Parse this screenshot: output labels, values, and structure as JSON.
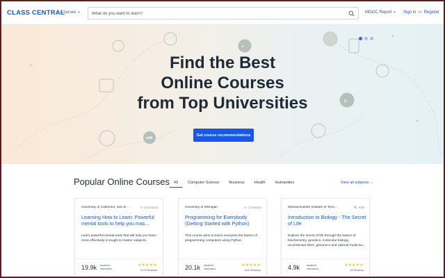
{
  "header": {
    "logo": "CLASS CENTRAL",
    "courses_label": "Courses",
    "search_placeholder": "What do you want to learn?",
    "mooc_report_label": "MOOC Report",
    "signin_label": "Sign in",
    "or_label": "or",
    "register_label": "Register"
  },
  "hero": {
    "title_line1": "Find the Best",
    "title_line2": "Online Courses",
    "title_line3": "from Top Universities",
    "cta_label": "Get course recommendations",
    "carousel_active_index": 0,
    "carousel_count": 3
  },
  "popular": {
    "title": "Popular Online Courses",
    "tabs": [
      "All",
      "Computer Science",
      "Business",
      "Health",
      "Humanities"
    ],
    "active_tab": "All",
    "view_all_label": "View all subjects →"
  },
  "cards": [
    {
      "university": "University of California, San D...",
      "provider": "Coursera",
      "title": "Learning How to Learn: Powerful mental tools to help you mas...",
      "description": "Learn powerful mental tools that will help you learn more effectively in tough-to-master subjects.",
      "count": "19.9k",
      "count_label1": "students",
      "count_label2": "interested",
      "stars": "★★★★★",
      "reviews": "2173 Reviews"
    },
    {
      "university": "University of Michigan",
      "provider": "Coursera",
      "title": "Programming for Everybody (Getting Started with Python)",
      "description": "This course aims to teach everyone the basics of programming computers using Python.",
      "count": "20.1k",
      "count_label1": "students",
      "count_label2": "interested",
      "stars": "★★★★★",
      "reviews": "1410 Reviews"
    },
    {
      "university": "Massachusetts Institute of Tech...",
      "provider": "edX",
      "title": "Introduction to Biology - The Secret of Life",
      "description": "Explore the secret of life through the basics of biochemistry, genetics, molecular biology, recombinant DNA, genomics and rational medicine.",
      "count": "4.9k",
      "count_label1": "students",
      "count_label2": "interested",
      "stars": "★★★★★",
      "reviews": "25 Reviews"
    }
  ],
  "colors": {
    "brand_blue": "#1a56c9",
    "cta_blue": "#1a56e8",
    "star_gold": "#f2c14e",
    "frame_border": "#5a1e1e"
  }
}
